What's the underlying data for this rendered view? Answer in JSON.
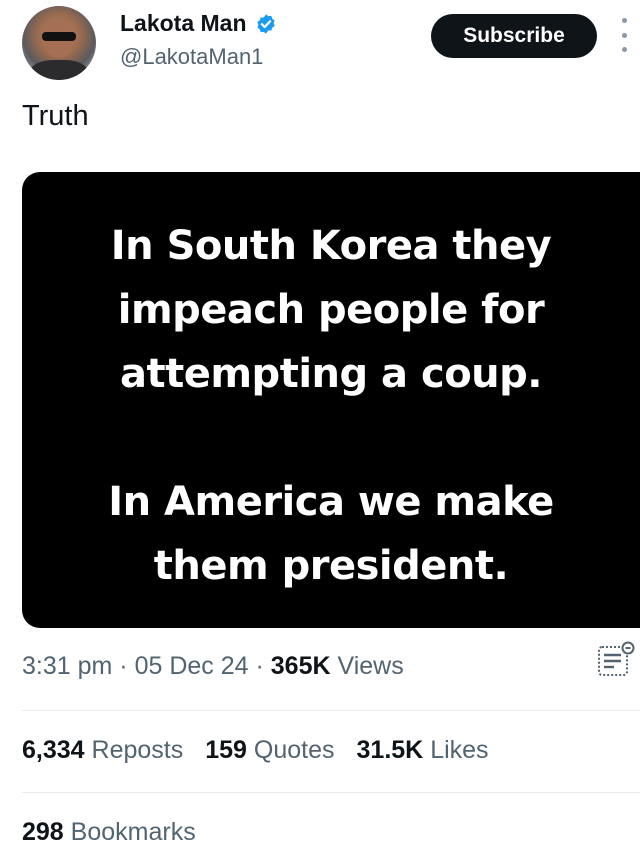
{
  "author": {
    "display_name": "Lakota Man",
    "handle": "@LakotaMan1",
    "verified_icon": "verified-badge-icon",
    "verified_color": "#1d9bf0"
  },
  "header": {
    "subscribe_label": "Subscribe",
    "more_icon": "more-vertical-icon"
  },
  "post": {
    "text": "Truth",
    "image_text": {
      "line1": "In South Korea they",
      "line2": "impeach people for",
      "line3": "attempting a coup.",
      "line4": "In America we make",
      "line5": "them president."
    }
  },
  "meta": {
    "time": "3:31 pm",
    "date": "05 Dec 24",
    "views_count": "365K",
    "views_label": "Views",
    "separator": "·"
  },
  "stats": {
    "reposts_count": "6,334",
    "reposts_label": "Reposts",
    "quotes_count": "159",
    "quotes_label": "Quotes",
    "likes_count": "31.5K",
    "likes_label": "Likes",
    "bookmarks_count": "298",
    "bookmarks_label": "Bookmarks"
  }
}
